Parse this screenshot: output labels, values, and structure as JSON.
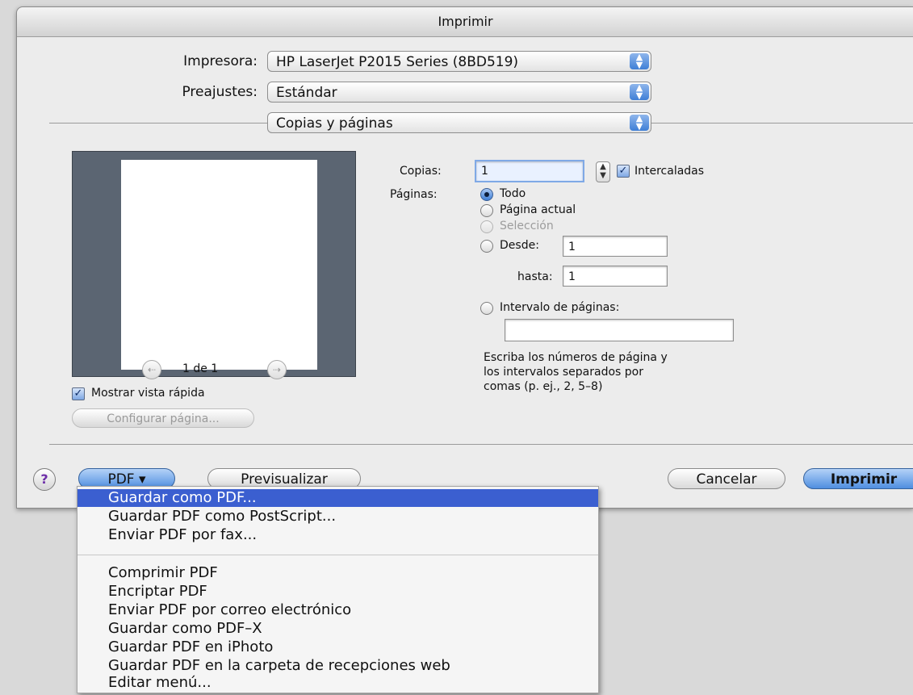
{
  "window": {
    "title": "Imprimir"
  },
  "printer": {
    "label": "Impresora:",
    "value": "HP LaserJet P2015 Series (8BD519)"
  },
  "presets": {
    "label": "Preajustes:",
    "value": "Estándar"
  },
  "section": {
    "value": "Copias y páginas"
  },
  "preview": {
    "page_indicator": "1 de 1",
    "show_quick_preview": "Mostrar vista rápida",
    "page_setup": "Configurar página..."
  },
  "copies": {
    "label": "Copias:",
    "value": "1",
    "collate": "Intercaladas"
  },
  "pages": {
    "label": "Páginas:",
    "all": "Todo",
    "current": "Página actual",
    "selection": "Selección",
    "from": "Desde:",
    "from_value": "1",
    "to": "hasta:",
    "to_value": "1",
    "range": "Intervalo de páginas:",
    "range_value": "",
    "hint_line1": "Escriba los números de página y",
    "hint_line2": "los intervalos separados por",
    "hint_line3": "comas (p. ej., 2, 5–8)"
  },
  "buttons": {
    "help": "?",
    "pdf": "PDF ▾",
    "preview": "Previsualizar",
    "cancel": "Cancelar",
    "print": "Imprimir"
  },
  "pdf_menu": {
    "items": [
      "Guardar como PDF...",
      "Guardar PDF como PostScript...",
      "Enviar PDF por fax...",
      "Comprimir PDF",
      "Encriptar PDF",
      "Enviar PDF por correo electrónico",
      "Guardar como PDF–X",
      "Guardar PDF en iPhoto",
      "Guardar PDF en la carpeta de recepciones web",
      "Editar menú..."
    ]
  }
}
